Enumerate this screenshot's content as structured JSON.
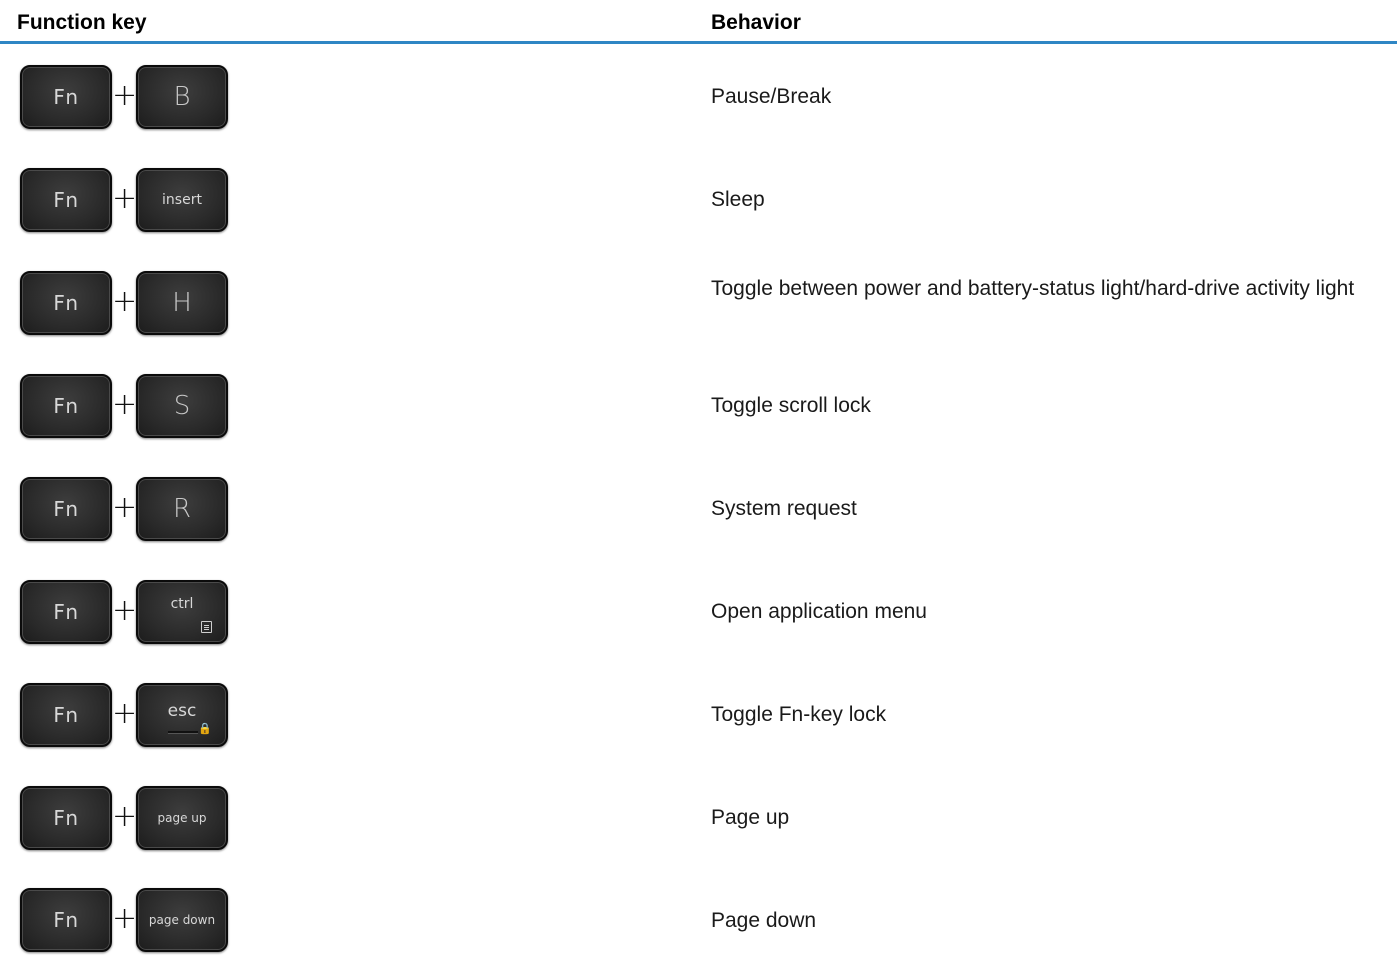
{
  "table": {
    "headers": {
      "key": "Function key",
      "behavior": "Behavior"
    },
    "rows": [
      {
        "fn": "Fn",
        "plus": "+",
        "key": "B",
        "behavior": "Pause/Break"
      },
      {
        "fn": "Fn",
        "plus": "+",
        "key": "insert",
        "behavior": "Sleep"
      },
      {
        "fn": "Fn",
        "plus": "+",
        "key": "H",
        "behavior": "Toggle between power and battery-status light/hard-drive activity light"
      },
      {
        "fn": "Fn",
        "plus": "+",
        "key": "S",
        "behavior": "Toggle scroll lock"
      },
      {
        "fn": "Fn",
        "plus": "+",
        "key": "R",
        "behavior": "System request"
      },
      {
        "fn": "Fn",
        "plus": "+",
        "key": "ctrl",
        "behavior": "Open application menu"
      },
      {
        "fn": "Fn",
        "plus": "+",
        "key": "esc",
        "behavior": "Toggle Fn-key lock"
      },
      {
        "fn": "Fn",
        "plus": "+",
        "key": "page up",
        "behavior": "Page up"
      },
      {
        "fn": "Fn",
        "plus": "+",
        "key": "page down",
        "behavior": "Page down"
      }
    ]
  },
  "icons": {
    "menu": "application-menu-icon",
    "lock": "lock-icon"
  },
  "colors": {
    "header_rule": "#2f86c4",
    "key_face": "#2a2a2a",
    "key_text": "#d8d8d8"
  }
}
